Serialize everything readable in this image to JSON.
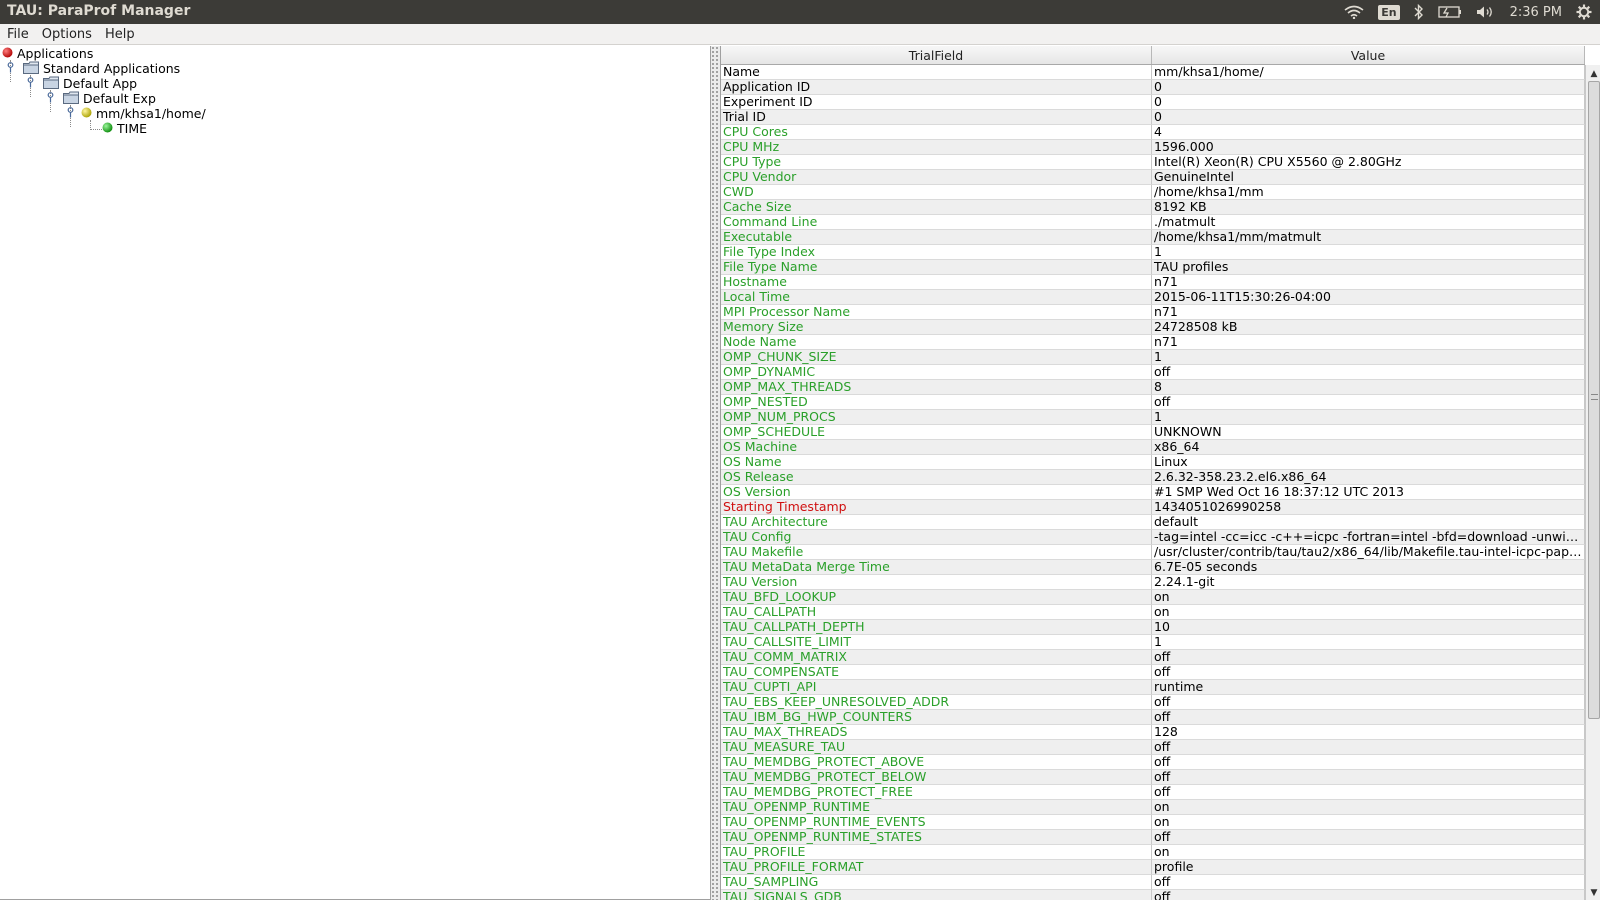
{
  "window": {
    "title": "TAU: ParaProf Manager"
  },
  "system_panel": {
    "lang": "En",
    "clock": "2:36 PM"
  },
  "menu": [
    {
      "label": "File"
    },
    {
      "label": "Options"
    },
    {
      "label": "Help"
    }
  ],
  "tree": [
    {
      "label": "Applications",
      "icon": "red-ball-icon"
    },
    {
      "label": "Standard Applications",
      "icon": "folder-icon"
    },
    {
      "label": "Default App",
      "icon": "folder-icon"
    },
    {
      "label": "Default Exp",
      "icon": "folder-icon"
    },
    {
      "label": "mm/khsa1/home/",
      "icon": "yellow-ball-icon"
    },
    {
      "label": "TIME",
      "icon": "green-ball-icon"
    }
  ],
  "table": {
    "columns": [
      "TrialField",
      "Value"
    ],
    "rows": [
      {
        "field": "Name",
        "value": "mm/khsa1/home/",
        "color": "black"
      },
      {
        "field": "Application ID",
        "value": "0",
        "color": "black"
      },
      {
        "field": "Experiment ID",
        "value": "0",
        "color": "black"
      },
      {
        "field": "Trial ID",
        "value": "0",
        "color": "black"
      },
      {
        "field": "CPU Cores",
        "value": "4",
        "color": "green"
      },
      {
        "field": "CPU MHz",
        "value": "1596.000",
        "color": "green"
      },
      {
        "field": "CPU Type",
        "value": "Intel(R) Xeon(R) CPU X5560 @ 2.80GHz",
        "color": "green"
      },
      {
        "field": "CPU Vendor",
        "value": "GenuineIntel",
        "color": "green"
      },
      {
        "field": "CWD",
        "value": "/home/khsa1/mm",
        "color": "green"
      },
      {
        "field": "Cache Size",
        "value": "8192 KB",
        "color": "green"
      },
      {
        "field": "Command Line",
        "value": "./matmult",
        "color": "green"
      },
      {
        "field": "Executable",
        "value": "/home/khsa1/mm/matmult",
        "color": "green"
      },
      {
        "field": "File Type Index",
        "value": "1",
        "color": "green"
      },
      {
        "field": "File Type Name",
        "value": "TAU profiles",
        "color": "green"
      },
      {
        "field": "Hostname",
        "value": "n71",
        "color": "green"
      },
      {
        "field": "Local Time",
        "value": "2015-06-11T15:30:26-04:00",
        "color": "green"
      },
      {
        "field": "MPI Processor Name",
        "value": "n71",
        "color": "green"
      },
      {
        "field": "Memory Size",
        "value": "24728508 kB",
        "color": "green"
      },
      {
        "field": "Node Name",
        "value": "n71",
        "color": "green"
      },
      {
        "field": "OMP_CHUNK_SIZE",
        "value": "1",
        "color": "green"
      },
      {
        "field": "OMP_DYNAMIC",
        "value": "off",
        "color": "green"
      },
      {
        "field": "OMP_MAX_THREADS",
        "value": "8",
        "color": "green"
      },
      {
        "field": "OMP_NESTED",
        "value": "off",
        "color": "green"
      },
      {
        "field": "OMP_NUM_PROCS",
        "value": "1",
        "color": "green"
      },
      {
        "field": "OMP_SCHEDULE",
        "value": "UNKNOWN",
        "color": "green"
      },
      {
        "field": "OS Machine",
        "value": "x86_64",
        "color": "green"
      },
      {
        "field": "OS Name",
        "value": "Linux",
        "color": "green"
      },
      {
        "field": "OS Release",
        "value": "2.6.32-358.23.2.el6.x86_64",
        "color": "green"
      },
      {
        "field": "OS Version",
        "value": "#1 SMP Wed Oct 16 18:37:12 UTC 2013",
        "color": "green"
      },
      {
        "field": "Starting Timestamp",
        "value": "1434051026990258",
        "color": "red"
      },
      {
        "field": "TAU Architecture",
        "value": "default",
        "color": "green"
      },
      {
        "field": "TAU Config",
        "value": "-tag=intel -cc=icc -c++=icpc -fortran=intel -bfd=download -unwin...",
        "color": "green"
      },
      {
        "field": "TAU Makefile",
        "value": "/usr/cluster/contrib/tau/tau2/x86_64/lib/Makefile.tau-intel-icpc-papi-...",
        "color": "green"
      },
      {
        "field": "TAU MetaData Merge Time",
        "value": "6.7E-05 seconds",
        "color": "green"
      },
      {
        "field": "TAU Version",
        "value": "2.24.1-git",
        "color": "green"
      },
      {
        "field": "TAU_BFD_LOOKUP",
        "value": "on",
        "color": "green"
      },
      {
        "field": "TAU_CALLPATH",
        "value": "on",
        "color": "green"
      },
      {
        "field": "TAU_CALLPATH_DEPTH",
        "value": "10",
        "color": "green"
      },
      {
        "field": "TAU_CALLSITE_LIMIT",
        "value": "1",
        "color": "green"
      },
      {
        "field": "TAU_COMM_MATRIX",
        "value": "off",
        "color": "green"
      },
      {
        "field": "TAU_COMPENSATE",
        "value": "off",
        "color": "green"
      },
      {
        "field": "TAU_CUPTI_API",
        "value": "runtime",
        "color": "green"
      },
      {
        "field": "TAU_EBS_KEEP_UNRESOLVED_ADDR",
        "value": "off",
        "color": "green"
      },
      {
        "field": "TAU_IBM_BG_HWP_COUNTERS",
        "value": "off",
        "color": "green"
      },
      {
        "field": "TAU_MAX_THREADS",
        "value": "128",
        "color": "green"
      },
      {
        "field": "TAU_MEASURE_TAU",
        "value": "off",
        "color": "green"
      },
      {
        "field": "TAU_MEMDBG_PROTECT_ABOVE",
        "value": "off",
        "color": "green"
      },
      {
        "field": "TAU_MEMDBG_PROTECT_BELOW",
        "value": "off",
        "color": "green"
      },
      {
        "field": "TAU_MEMDBG_PROTECT_FREE",
        "value": "off",
        "color": "green"
      },
      {
        "field": "TAU_OPENMP_RUNTIME",
        "value": "on",
        "color": "green"
      },
      {
        "field": "TAU_OPENMP_RUNTIME_EVENTS",
        "value": "on",
        "color": "green"
      },
      {
        "field": "TAU_OPENMP_RUNTIME_STATES",
        "value": "off",
        "color": "green"
      },
      {
        "field": "TAU_PROFILE",
        "value": "on",
        "color": "green"
      },
      {
        "field": "TAU_PROFILE_FORMAT",
        "value": "profile",
        "color": "green"
      },
      {
        "field": "TAU_SAMPLING",
        "value": "off",
        "color": "green"
      },
      {
        "field": "TAU_SIGNALS_GDB",
        "value": "off",
        "color": "green"
      }
    ]
  }
}
